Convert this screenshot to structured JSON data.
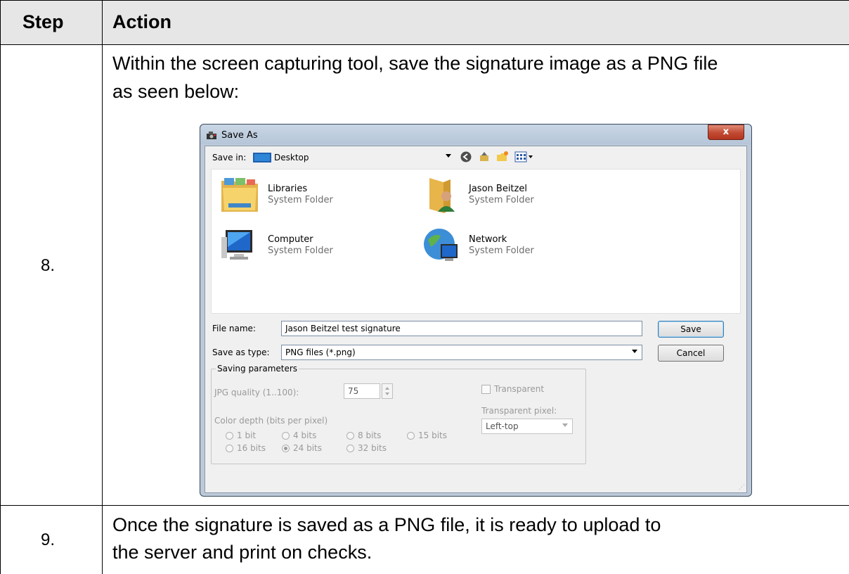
{
  "table": {
    "header_step": "Step",
    "header_action": "Action",
    "rows": [
      {
        "step": "8.",
        "action_lines": [
          "Within the screen capturing tool, save the signature image as a PNG file",
          "as seen below:"
        ]
      },
      {
        "step": "9.",
        "action_lines": [
          "Once the signature is saved as a PNG file, it is ready to upload to",
          "the server and print on checks."
        ]
      }
    ]
  },
  "dialog": {
    "title": "Save As",
    "close_label": "x",
    "save_in_label": "Save in:",
    "save_in_value": "Desktop",
    "items": [
      {
        "name": "Libraries",
        "sub": "System Folder",
        "icon": "libraries-folder-icon"
      },
      {
        "name": "Jason Beitzel",
        "sub": "System Folder",
        "icon": "user-folder-icon"
      },
      {
        "name": "Computer",
        "sub": "System Folder",
        "icon": "computer-icon"
      },
      {
        "name": "Network",
        "sub": "System Folder",
        "icon": "network-globe-icon"
      }
    ],
    "file_name_label": "File name:",
    "file_name_value": "Jason Beitzel test signature",
    "save_as_type_label": "Save as type:",
    "save_as_type_value": "PNG files (*.png)",
    "save_button": "Save",
    "cancel_button": "Cancel",
    "params": {
      "group_title": "Saving parameters",
      "jpg_quality_label": "JPG quality (1..100):",
      "jpg_quality_value": "75",
      "color_depth_label": "Color depth (bits per pixel)",
      "depth_options": [
        "1 bit",
        "4 bits",
        "8 bits",
        "15 bits",
        "16 bits",
        "24 bits",
        "32 bits"
      ],
      "selected_depth": "24 bits",
      "transparent_label": "Transparent",
      "transparent_pixel_label": "Transparent pixel:",
      "transparent_pixel_value": "Left-top"
    }
  }
}
